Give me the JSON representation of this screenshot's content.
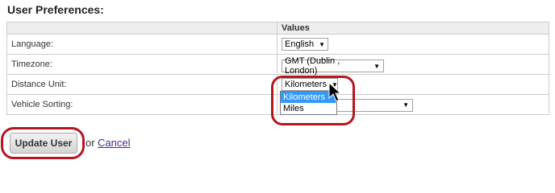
{
  "page": {
    "heading": "User Preferences:"
  },
  "table": {
    "header_left": "",
    "header_right": "Values",
    "rows": [
      {
        "label": "Language:",
        "value": "English"
      },
      {
        "label": "Timezone:",
        "value": "GMT (Dublin , London)"
      },
      {
        "label": "Distance Unit:",
        "value": "Kilometers"
      },
      {
        "label": "Vehicle Sorting:",
        "value": ""
      }
    ]
  },
  "dropdown": {
    "options": [
      "Kilometers",
      "Miles"
    ],
    "highlighted": "Kilometers"
  },
  "actions": {
    "update_label": "Update User",
    "or_text": "or",
    "cancel_label": "Cancel"
  },
  "colors": {
    "annotation": "#b5161d",
    "highlight": "#3399ff",
    "link": "#4a2a8c"
  }
}
